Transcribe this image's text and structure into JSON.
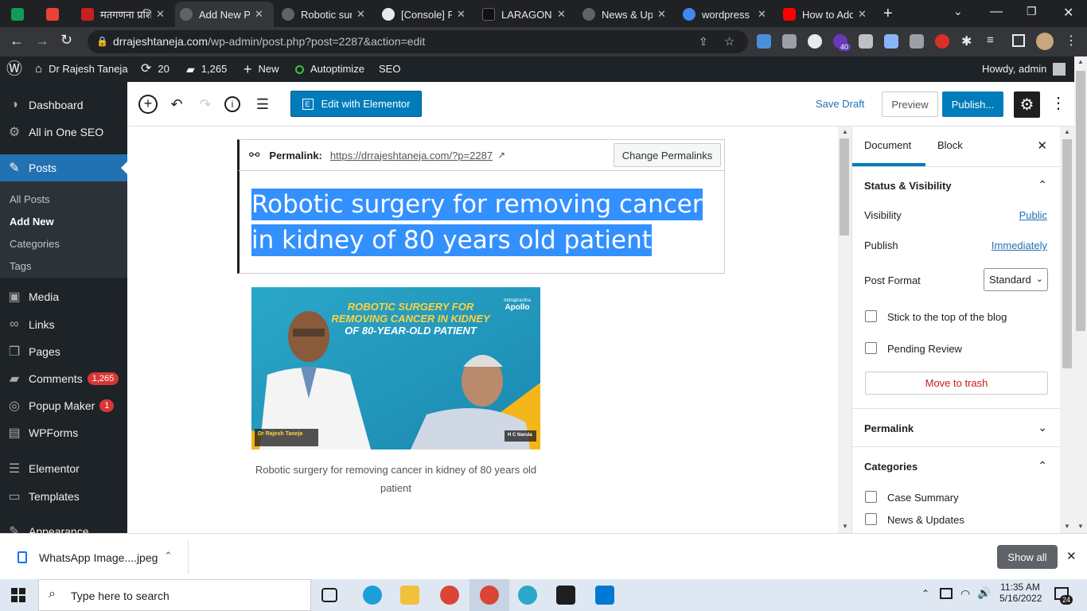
{
  "browser": {
    "tabs": [
      {
        "title": "",
        "favicon": "green-flag-icon",
        "color": "#0f9d58"
      },
      {
        "title": "",
        "favicon": "gmail-icon",
        "color": "#ea4335"
      },
      {
        "title": "मतगणना प्रशि",
        "favicon": "video-icon",
        "color": "#c5221f"
      },
      {
        "title": "Add New Po",
        "favicon": "wp-icon",
        "color": "#5f6368",
        "active": true
      },
      {
        "title": "Robotic sur",
        "favicon": "wp-icon",
        "color": "#5f6368"
      },
      {
        "title": "[Console] P",
        "favicon": "github-icon",
        "color": "#e8eaed"
      },
      {
        "title": "LARAGON -",
        "favicon": "laragon-icon",
        "color": "#202124"
      },
      {
        "title": "News & Up",
        "favicon": "wp-icon",
        "color": "#5f6368"
      },
      {
        "title": "wordpress l",
        "favicon": "google-icon",
        "color": "#4285f4"
      },
      {
        "title": "How to Add",
        "favicon": "youtube-icon",
        "color": "#ff0000"
      }
    ],
    "url_host": "drrajeshtaneja.com",
    "url_path": "/wp-admin/post.php?post=2287&action=edit",
    "ext_badge": "40"
  },
  "adminbar": {
    "site_name": "Dr Rajesh Taneja",
    "updates": "20",
    "comments": "1,265",
    "new_label": "New",
    "autoptimize": "Autoptimize",
    "seo": "SEO",
    "howdy": "Howdy, admin"
  },
  "sidebar": {
    "items": [
      {
        "label": "Dashboard",
        "icon": "dashboard-icon"
      },
      {
        "label": "All in One SEO",
        "icon": "seo-icon"
      },
      {
        "label": "Posts",
        "icon": "pin-icon",
        "current": true
      },
      {
        "label": "Media",
        "icon": "media-icon"
      },
      {
        "label": "Links",
        "icon": "link-icon"
      },
      {
        "label": "Pages",
        "icon": "pages-icon"
      },
      {
        "label": "Comments",
        "icon": "comments-icon",
        "badge": "1,265"
      },
      {
        "label": "Popup Maker",
        "icon": "popup-icon",
        "badge": "1"
      },
      {
        "label": "WPForms",
        "icon": "forms-icon"
      },
      {
        "label": "Elementor",
        "icon": "elementor-icon"
      },
      {
        "label": "Templates",
        "icon": "folder-icon"
      },
      {
        "label": "Appearance",
        "icon": "appearance-icon"
      }
    ],
    "submenu": [
      "All Posts",
      "Add New",
      "Categories",
      "Tags"
    ]
  },
  "toolbar": {
    "elementor_label": "Edit with Elementor",
    "save_draft": "Save Draft",
    "preview": "Preview",
    "publish": "Publish..."
  },
  "editor": {
    "permalink_label": "Permalink:",
    "permalink_url": "https://drrajeshtaneja.com/?p=2287",
    "change_permalinks": "Change Permalinks",
    "title": "Robotic surgery for removing cancer in kidney of 80 years old patient",
    "image_headline_1": "ROBOTIC SURGERY FOR",
    "image_headline_2": "REMOVING CANCER IN KIDNEY",
    "image_headline_3": "OF 80-YEAR-OLD PATIENT",
    "image_logo_top": "Indraprastha",
    "image_logo": "Apollo",
    "image_doctor": "Dr Rajesh Taneja",
    "image_patient": "H C Narula",
    "caption": "Robotic surgery for removing cancer in kidney of 80 years old patient"
  },
  "panel": {
    "tab_document": "Document",
    "tab_block": "Block",
    "status_heading": "Status & Visibility",
    "visibility_label": "Visibility",
    "visibility_value": "Public",
    "publish_label": "Publish",
    "publish_value": "Immediately",
    "format_label": "Post Format",
    "format_value": "Standard",
    "stick_label": "Stick to the top of the blog",
    "pending_label": "Pending Review",
    "trash_label": "Move to trash",
    "permalink_heading": "Permalink",
    "categories_heading": "Categories",
    "categories": [
      "Case Summary",
      "News & Updates"
    ]
  },
  "download": {
    "filename": "WhatsApp Image....jpeg",
    "show_all": "Show all"
  },
  "taskbar": {
    "search_placeholder": "Type here to search",
    "time": "11:35 AM",
    "date": "5/16/2022",
    "notif_count": "24"
  },
  "colors": {
    "wp_blue": "#2271b1",
    "admin_dark": "#1d2327",
    "publish_blue": "#007cba",
    "title_highlight": "#3390ff"
  }
}
